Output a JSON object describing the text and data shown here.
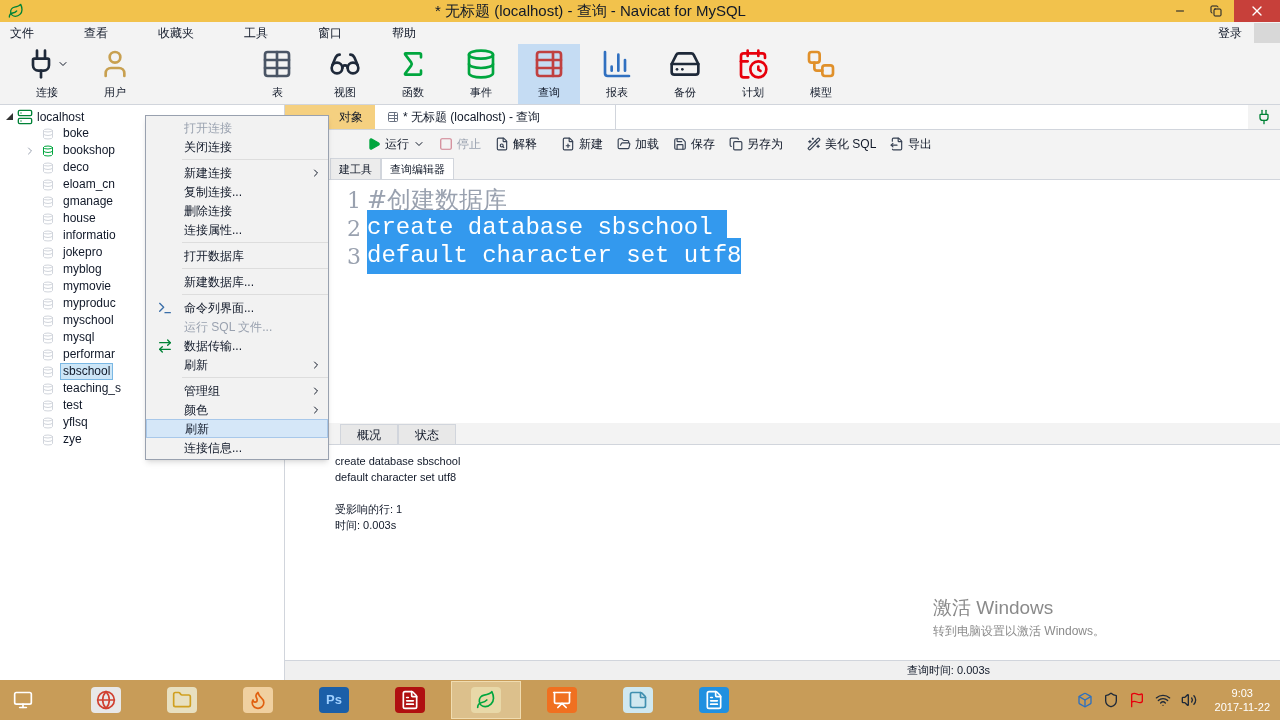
{
  "window": {
    "title": "* 无标题 (localhost) - 查询 - Navicat for MySQL"
  },
  "menu_bar": [
    "文件",
    "查看",
    "收藏夹",
    "工具",
    "窗口",
    "帮助"
  ],
  "login": "登录",
  "toolbar": [
    {
      "label": "连接",
      "selected": false,
      "dropdown": true
    },
    {
      "label": "用户",
      "selected": false,
      "dropdown": false
    },
    {
      "label": "表",
      "selected": false,
      "dropdown": false
    },
    {
      "label": "视图",
      "selected": false,
      "dropdown": false
    },
    {
      "label": "函数",
      "selected": false,
      "dropdown": false
    },
    {
      "label": "事件",
      "selected": false,
      "dropdown": false
    },
    {
      "label": "查询",
      "selected": true,
      "dropdown": false
    },
    {
      "label": "报表",
      "selected": false,
      "dropdown": false
    },
    {
      "label": "备份",
      "selected": false,
      "dropdown": false
    },
    {
      "label": "计划",
      "selected": false,
      "dropdown": false
    },
    {
      "label": "模型",
      "selected": false,
      "dropdown": false
    }
  ],
  "tree": {
    "label": "localhost",
    "expanded": true,
    "children": [
      {
        "label": "boke",
        "selected": false,
        "open": false
      },
      {
        "label": "bookshop",
        "selected": false,
        "open": true
      },
      {
        "label": "deco",
        "selected": false,
        "open": false
      },
      {
        "label": "eloam_cn",
        "selected": false,
        "open": false
      },
      {
        "label": "gmanage",
        "selected": false,
        "open": false
      },
      {
        "label": "house",
        "selected": false,
        "open": false
      },
      {
        "label": "informatio",
        "selected": false,
        "open": false
      },
      {
        "label": "jokepro",
        "selected": false,
        "open": false
      },
      {
        "label": "myblog",
        "selected": false,
        "open": false
      },
      {
        "label": "mymovie",
        "selected": false,
        "open": false
      },
      {
        "label": "myproduc",
        "selected": false,
        "open": false
      },
      {
        "label": "myschool",
        "selected": false,
        "open": false
      },
      {
        "label": "mysql",
        "selected": false,
        "open": false
      },
      {
        "label": "performar",
        "selected": false,
        "open": false
      },
      {
        "label": "sbschool",
        "selected": true,
        "open": false
      },
      {
        "label": "teaching_s",
        "selected": false,
        "open": false
      },
      {
        "label": "test",
        "selected": false,
        "open": false
      },
      {
        "label": "yflsq",
        "selected": false,
        "open": false
      },
      {
        "label": "zye",
        "selected": false,
        "open": false
      }
    ]
  },
  "doc_tabs": [
    {
      "label": "对象",
      "selected": false
    },
    {
      "label": "* 无标题 (localhost) - 查询",
      "selected": true
    }
  ],
  "query_toolbar": [
    {
      "label": "运行",
      "disabled": false,
      "dropdown": true
    },
    {
      "label": "停止",
      "disabled": true,
      "dropdown": false
    },
    {
      "label": "解释",
      "disabled": false,
      "dropdown": false
    },
    {
      "label": "新建",
      "disabled": false,
      "dropdown": false
    },
    {
      "label": "加载",
      "disabled": false,
      "dropdown": false
    },
    {
      "label": "保存",
      "disabled": false,
      "dropdown": false
    },
    {
      "label": "另存为",
      "disabled": false,
      "dropdown": false
    },
    {
      "label": "美化 SQL",
      "disabled": false,
      "dropdown": false
    },
    {
      "label": "导出",
      "disabled": false,
      "dropdown": false
    }
  ],
  "editor_tabs": [
    {
      "label": "建工具",
      "selected": false
    },
    {
      "label": "查询编辑器",
      "selected": true
    }
  ],
  "editor_lines": [
    {
      "number": "1",
      "text": "#创建数据库",
      "kind": "comment",
      "selected": false
    },
    {
      "number": "2",
      "text": "create database sbschool ",
      "kind": "code",
      "selected": true
    },
    {
      "number": "3",
      "text": "default character set utf8",
      "kind": "code",
      "selected": true
    }
  ],
  "result_tabs": [
    {
      "label": "概况",
      "selected": false
    },
    {
      "label": "状态",
      "selected": false
    }
  ],
  "result_sql": [
    "create database sbschool",
    "default character set utf8"
  ],
  "result_info": [
    "受影响的行: 1",
    "时间: 0.003s"
  ],
  "activation": {
    "title": "激活 Windows",
    "text": "转到电脑设置以激活 Windows。"
  },
  "status_bar": {
    "query_time": "查询时间: 0.003s"
  },
  "context_menu": [
    {
      "kind": "item",
      "label": "打开连接",
      "disabled": true,
      "submenu": false,
      "selected": false
    },
    {
      "kind": "item",
      "label": "关闭连接",
      "disabled": false,
      "submenu": false,
      "selected": false
    },
    {
      "kind": "separator"
    },
    {
      "kind": "item",
      "label": "新建连接",
      "disabled": false,
      "submenu": true,
      "selected": false
    },
    {
      "kind": "item",
      "label": "复制连接...",
      "disabled": false,
      "submenu": false,
      "selected": false
    },
    {
      "kind": "item",
      "label": "删除连接",
      "disabled": false,
      "submenu": false,
      "selected": false
    },
    {
      "kind": "item",
      "label": "连接属性...",
      "disabled": false,
      "submenu": false,
      "selected": false
    },
    {
      "kind": "separator"
    },
    {
      "kind": "item",
      "label": "打开数据库",
      "disabled": false,
      "submenu": false,
      "selected": false
    },
    {
      "kind": "separator"
    },
    {
      "kind": "item",
      "label": "新建数据库...",
      "disabled": false,
      "submenu": false,
      "selected": false
    },
    {
      "kind": "separator"
    },
    {
      "kind": "console",
      "label": "命令列界面...",
      "disabled": false,
      "submenu": false,
      "selected": false
    },
    {
      "kind": "item",
      "label": "运行 SQL 文件...",
      "disabled": true,
      "submenu": false,
      "selected": false
    },
    {
      "kind": "transfer",
      "label": "数据传输...",
      "disabled": false,
      "submenu": false,
      "selected": false
    },
    {
      "kind": "item",
      "label": "刷新",
      "disabled": false,
      "submenu": true,
      "selected": false
    },
    {
      "kind": "separator"
    },
    {
      "kind": "item",
      "label": "管理组",
      "disabled": false,
      "submenu": true,
      "selected": false
    },
    {
      "kind": "item",
      "label": "颜色",
      "disabled": false,
      "submenu": true,
      "selected": false
    },
    {
      "kind": "item",
      "label": "刷新",
      "disabled": false,
      "submenu": false,
      "selected": true
    },
    {
      "kind": "item",
      "label": "连接信息...",
      "disabled": false,
      "submenu": false,
      "selected": false
    }
  ],
  "taskbar": {
    "apps": [
      {
        "kind": "browser",
        "active": false
      },
      {
        "kind": "folder",
        "active": false
      },
      {
        "kind": "firefox",
        "active": false
      },
      {
        "kind": "ps",
        "label": "Ps",
        "active": false
      },
      {
        "kind": "pdf",
        "active": false
      },
      {
        "kind": "navicat",
        "active": true
      },
      {
        "kind": "slides",
        "active": false
      },
      {
        "kind": "notes",
        "active": false
      },
      {
        "kind": "word",
        "active": false
      }
    ],
    "time": "9:03",
    "date": "2017-11-22"
  }
}
